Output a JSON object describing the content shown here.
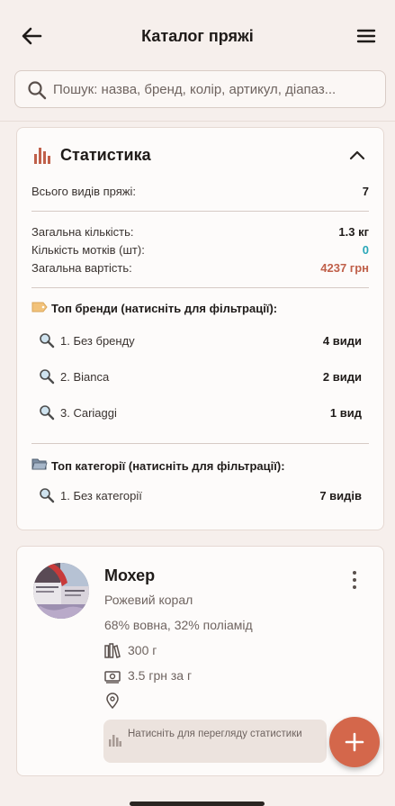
{
  "header": {
    "title": "Каталог пряжі",
    "back_icon": "arrow-left-icon",
    "menu_icon": "hamburger-menu-icon"
  },
  "search": {
    "placeholder": "Пошук: назва, бренд, колір, артикул, діапаз...",
    "value": ""
  },
  "stats": {
    "title": "Статистика",
    "total_types_label": "Всього видів пряжі:",
    "total_types_value": "7",
    "total_qty_label": "Загальна кількість:",
    "total_qty_value": "1.3 кг",
    "skeins_label": "Кількість мотків (шт):",
    "skeins_value": "0",
    "total_cost_label": "Загальна вартість:",
    "total_cost_value": "4237 грн",
    "top_brands_title": "Топ бренди (натисніть для фільтрації):",
    "brands": [
      {
        "label": "1. Без бренду",
        "count": "4 види"
      },
      {
        "label": "2. Bianca",
        "count": "2 види"
      },
      {
        "label": "3. Cariaggi",
        "count": "1 вид"
      }
    ],
    "top_categories_title": "Топ категорії (натисніть для фільтрації):",
    "categories": [
      {
        "label": "1. Без категорії",
        "count": "7 видів"
      }
    ]
  },
  "yarn": {
    "name": "Мохер",
    "color": "Рожевий корал",
    "composition": "68% вовна, 32% поліамід",
    "weight": "300 г",
    "price": "3.5 грн за г",
    "location": "",
    "stats_hint": "Натисніть для перегляду статистики"
  },
  "colors": {
    "accent": "#d4674b",
    "teal": "#2aa7b8",
    "cost": "#c0604a",
    "background": "#f6efec"
  }
}
